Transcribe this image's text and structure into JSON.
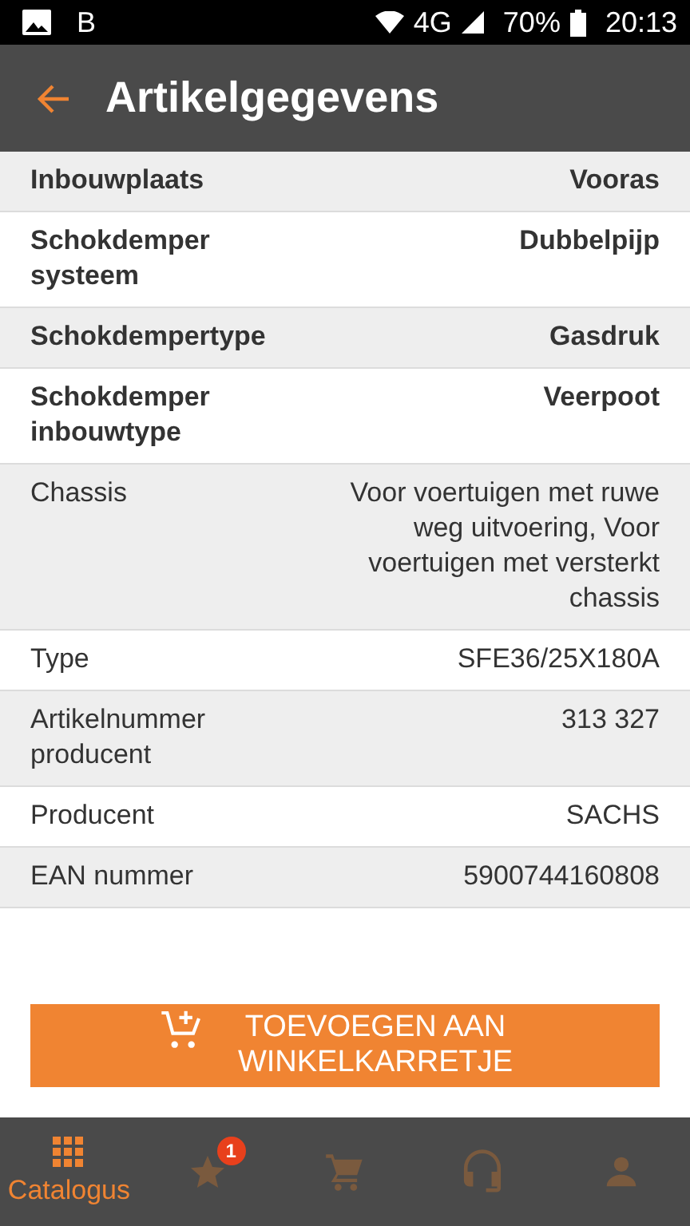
{
  "status_bar": {
    "carrier": "B",
    "network": "4G",
    "battery": "70%",
    "time": "20:13"
  },
  "app_bar": {
    "title": "Artikelgegevens"
  },
  "details": [
    {
      "kind": "bold",
      "label": "Inbouwplaats",
      "value": "Vooras"
    },
    {
      "kind": "bold",
      "label": "Schokdemper systeem",
      "value": "Dubbelpijp"
    },
    {
      "kind": "bold",
      "label": "Schokdempertype",
      "value": "Gasdruk"
    },
    {
      "kind": "bold",
      "label": "Schokdemper inbouwtype",
      "value": "Veerpoot"
    },
    {
      "kind": "plain",
      "label": "Chassis",
      "value": "Voor voertuigen met ruwe weg uitvoering, Voor voertuigen met versterkt chassis"
    },
    {
      "kind": "plain",
      "label": "Type",
      "value": "SFE36/25X180A"
    },
    {
      "kind": "plain",
      "label": "Artikelnummer producent",
      "value": "313 327"
    },
    {
      "kind": "plain",
      "label": "Producent",
      "value": "SACHS"
    },
    {
      "kind": "plain",
      "label": "EAN nummer",
      "value": "5900744160808"
    }
  ],
  "add_button": {
    "label": "TOEVOEGEN AAN WINKELKARRETJE"
  },
  "bottom_nav": [
    {
      "kind": "grid",
      "label": "Catalogus",
      "selected": true
    },
    {
      "kind": "star",
      "badge": "1",
      "selected": false
    },
    {
      "kind": "cart",
      "selected": false
    },
    {
      "kind": "headset",
      "selected": false
    },
    {
      "kind": "person",
      "selected": false
    }
  ]
}
